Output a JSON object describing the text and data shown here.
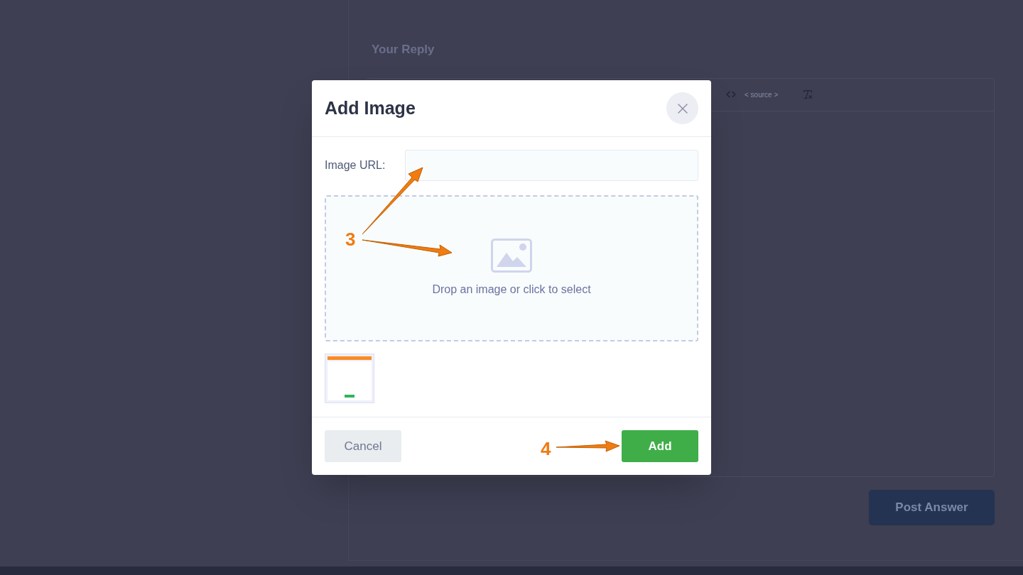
{
  "background": {
    "reply_heading": "Your Reply",
    "toolbar": {
      "source_label": "< source >"
    },
    "post_button": "Post Answer"
  },
  "dialog": {
    "title": "Add Image",
    "url_label": "Image URL:",
    "dropzone_text": "Drop an image or click to select",
    "cancel_button": "Cancel",
    "add_button": "Add"
  },
  "annotations": [
    {
      "label": "3"
    },
    {
      "label": "4"
    }
  ]
}
